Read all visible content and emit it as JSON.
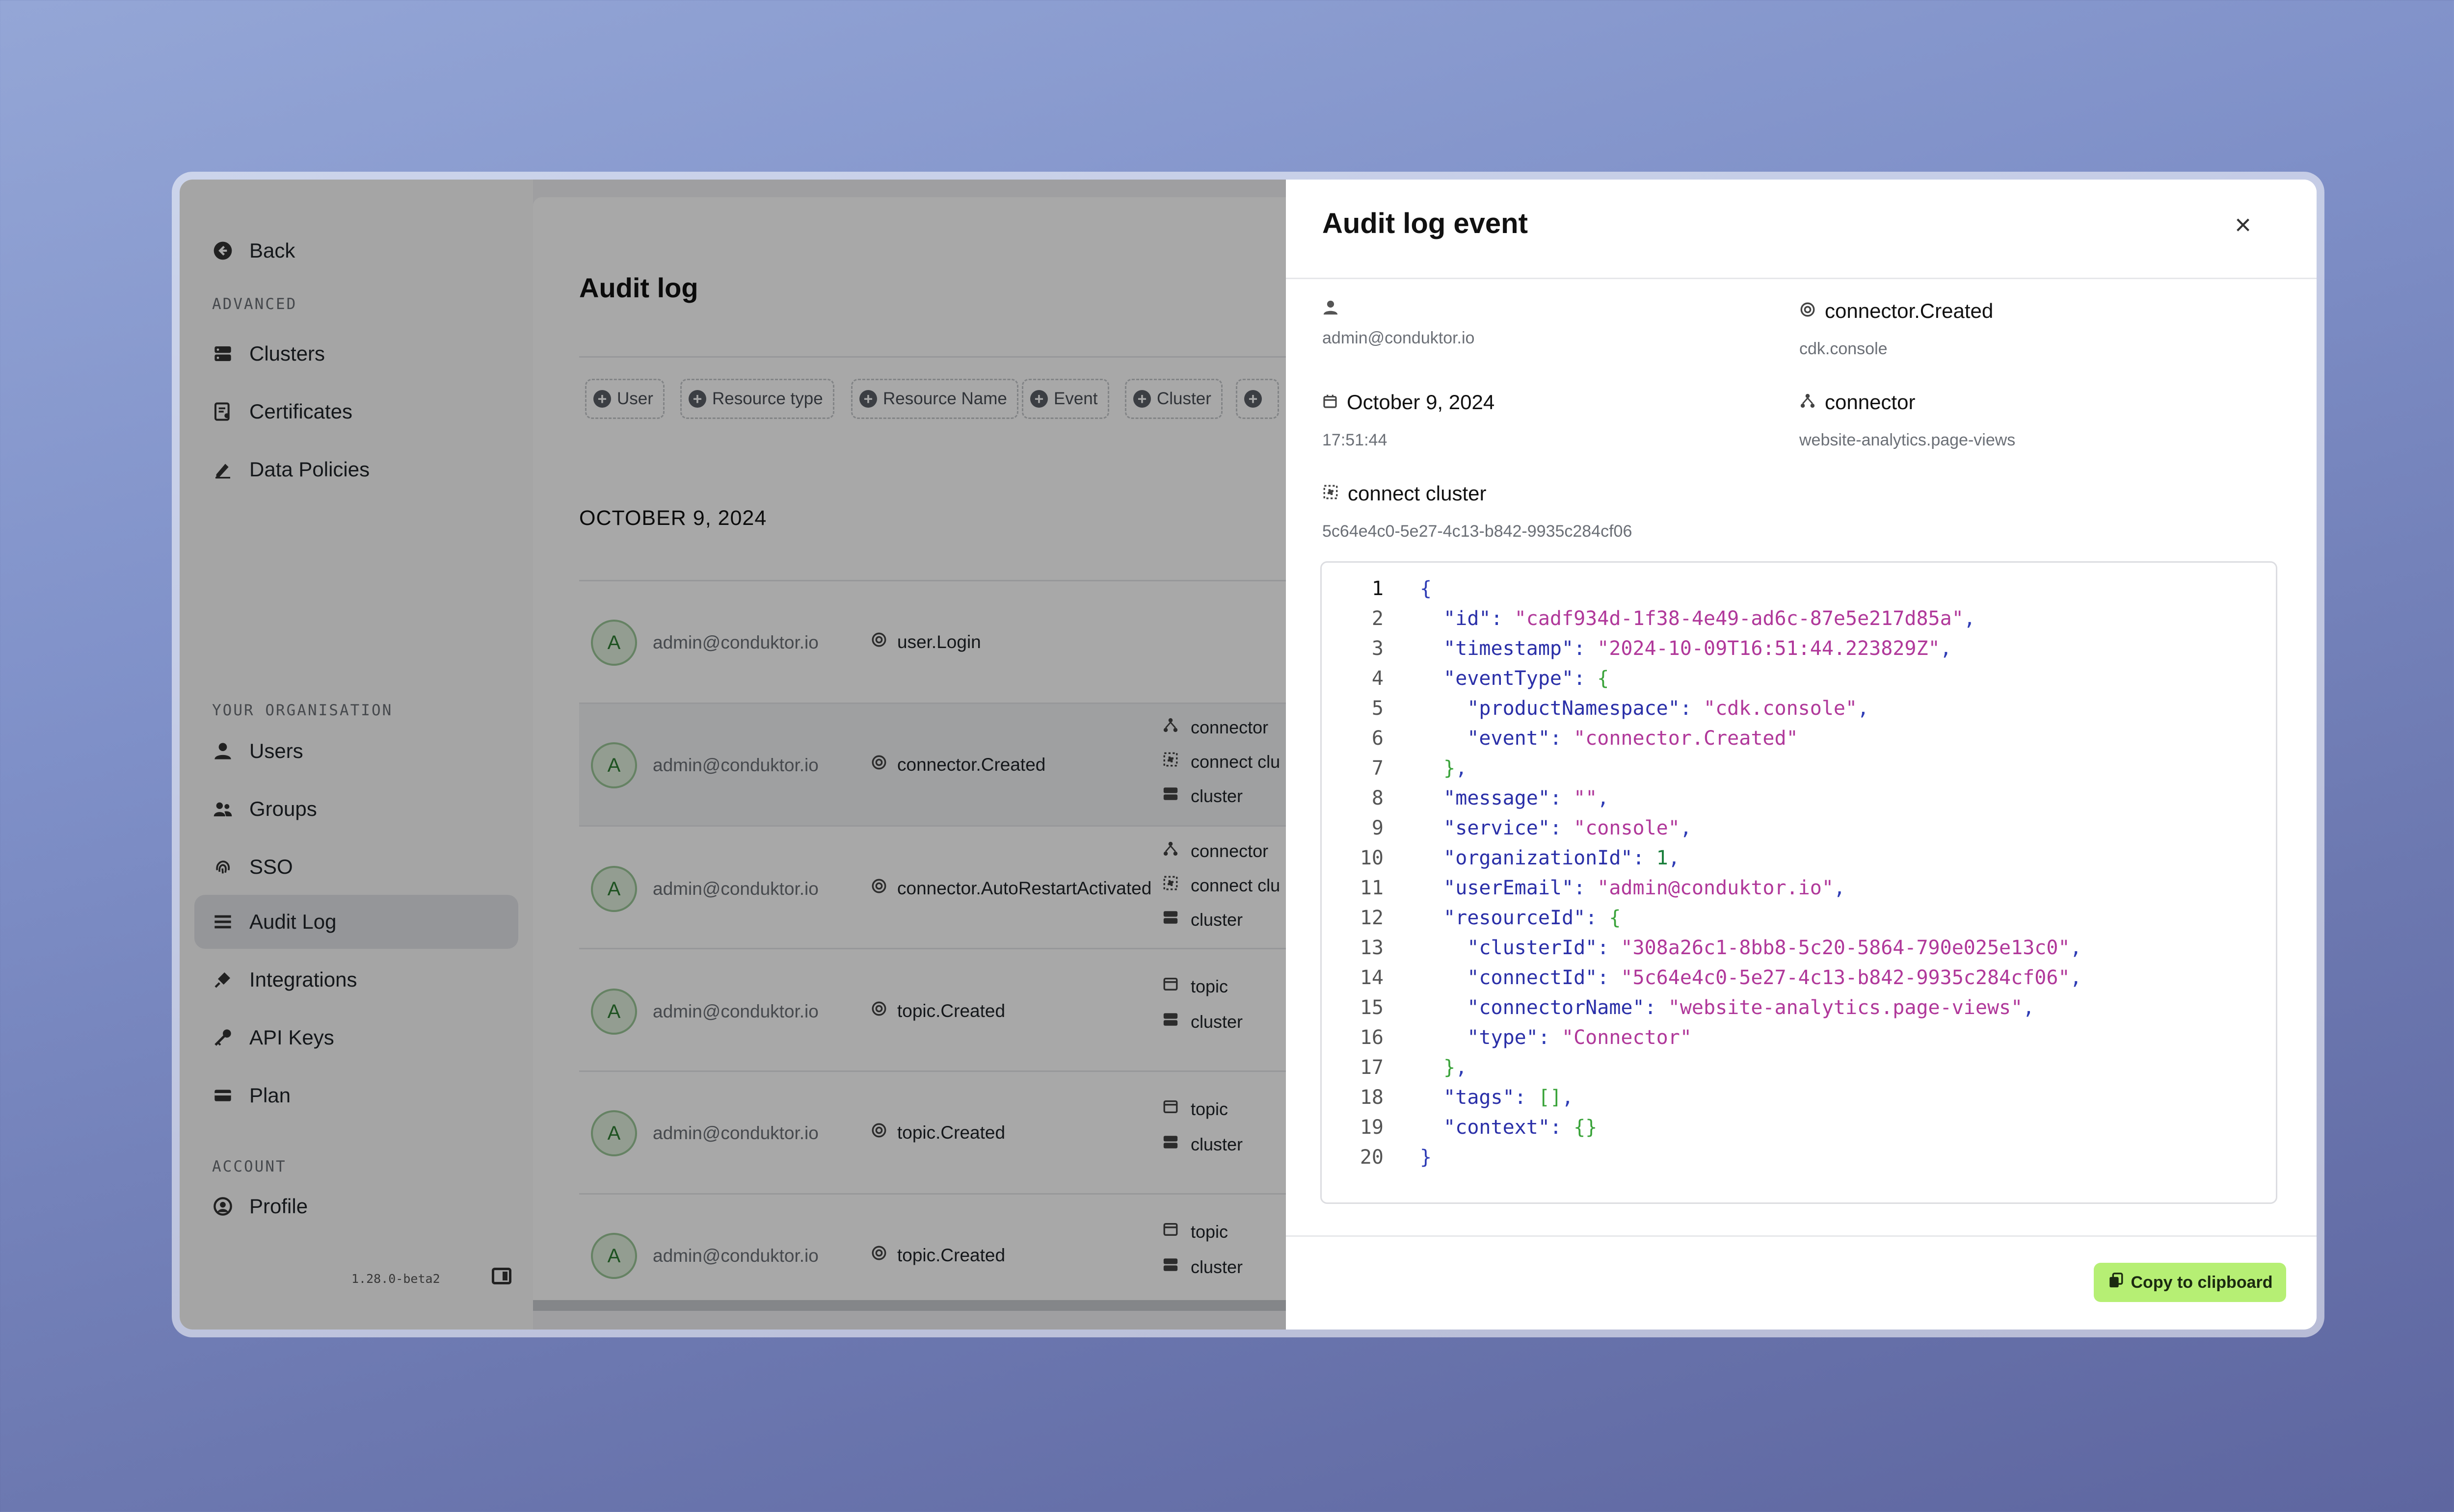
{
  "sidebar": {
    "back_label": "Back",
    "sections": [
      {
        "title": "ADVANCED"
      },
      {
        "title": "YOUR ORGANISATION"
      },
      {
        "title": "ACCOUNT"
      }
    ],
    "items": [
      {
        "label": "Clusters",
        "icon": "server-icon"
      },
      {
        "label": "Certificates",
        "icon": "certificate-icon"
      },
      {
        "label": "Data Policies",
        "icon": "pen-icon"
      },
      {
        "label": "Users",
        "icon": "user-icon"
      },
      {
        "label": "Groups",
        "icon": "users-icon"
      },
      {
        "label": "SSO",
        "icon": "fingerprint-icon"
      },
      {
        "label": "Audit Log",
        "icon": "list-icon",
        "active": true
      },
      {
        "label": "Integrations",
        "icon": "plug-icon"
      },
      {
        "label": "API Keys",
        "icon": "key-icon"
      },
      {
        "label": "Plan",
        "icon": "credit-card-icon"
      },
      {
        "label": "Profile",
        "icon": "profile-circle-icon"
      }
    ],
    "version": "1.28.0-beta2"
  },
  "main": {
    "title": "Audit log",
    "filters": [
      "User",
      "Resource type",
      "Resource Name",
      "Event",
      "Cluster",
      ""
    ],
    "date_heading": "OCTOBER 9, 2024",
    "rows": [
      {
        "initial": "A",
        "email": "admin@conduktor.io",
        "event": "user.Login",
        "resources": []
      },
      {
        "initial": "A",
        "email": "admin@conduktor.io",
        "event": "connector.Created",
        "resources": [
          "connector",
          "connect clu",
          "cluster"
        ]
      },
      {
        "initial": "A",
        "email": "admin@conduktor.io",
        "event": "connector.AutoRestartActivated",
        "resources": [
          "connector",
          "connect clu",
          "cluster"
        ]
      },
      {
        "initial": "A",
        "email": "admin@conduktor.io",
        "event": "topic.Created",
        "resources": [
          "topic",
          "cluster"
        ]
      },
      {
        "initial": "A",
        "email": "admin@conduktor.io",
        "event": "topic.Created",
        "resources": [
          "topic",
          "cluster"
        ]
      },
      {
        "initial": "A",
        "email": "admin@conduktor.io",
        "event": "topic.Created",
        "resources": [
          "topic",
          "cluster"
        ]
      }
    ]
  },
  "drawer": {
    "title": "Audit log event",
    "user_email": "admin@conduktor.io",
    "event_type": "connector.Created",
    "event_namespace": "cdk.console",
    "date": "October 9, 2024",
    "time": "17:51:44",
    "resource_type": "connector",
    "resource_name": "website-analytics.page-views",
    "connect_label": "connect cluster",
    "connect_id": "5c64e4c0-5e27-4c13-b842-9935c284cf06",
    "copy_label": "Copy to clipboard",
    "code_lines": [
      "{",
      "  \"id\": \"cadf934d-1f38-4e49-ad6c-87e5e217d85a\",",
      "  \"timestamp\": \"2024-10-09T16:51:44.223829Z\",",
      "  \"eventType\": {",
      "    \"productNamespace\": \"cdk.console\",",
      "    \"event\": \"connector.Created\"",
      "  },",
      "  \"message\": \"\",",
      "  \"service\": \"console\",",
      "  \"organizationId\": 1,",
      "  \"userEmail\": \"admin@conduktor.io\",",
      "  \"resourceId\": {",
      "    \"clusterId\": \"308a26c1-8bb8-5c20-5864-790e025e13c0\",",
      "    \"connectId\": \"5c64e4c0-5e27-4c13-b842-9935c284cf06\",",
      "    \"connectorName\": \"website-analytics.page-views\",",
      "    \"type\": \"Connector\"",
      "  },",
      "  \"tags\": [],",
      "  \"context\": {}",
      "}"
    ]
  },
  "colors": {
    "accent_button": "#b6ef74",
    "json_key": "#2a2fa8",
    "json_string": "#b0389a",
    "json_number": "#1a7f3c"
  }
}
